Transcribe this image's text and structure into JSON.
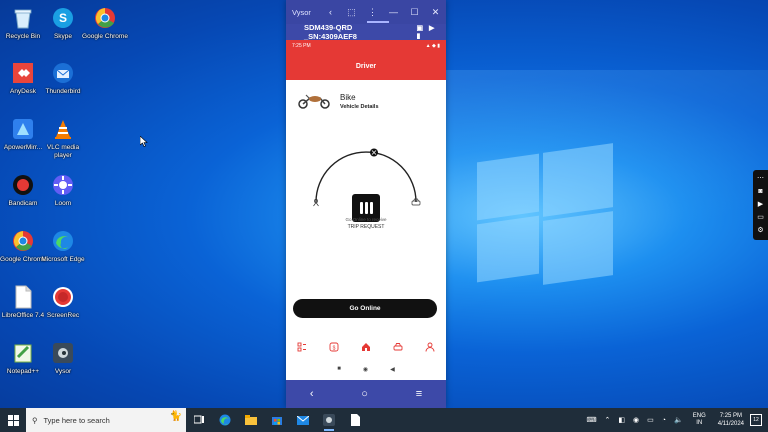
{
  "desktop": {
    "icons": [
      {
        "label": "Recycle Bin"
      },
      {
        "label": "Skype"
      },
      {
        "label": "Google Chrome"
      },
      {
        "label": "AnyDesk"
      },
      {
        "label": "Thunderbird"
      },
      {
        "label": "ApowerMirr..."
      },
      {
        "label": "VLC media player"
      },
      {
        "label": "Bandicam"
      },
      {
        "label": "Loom"
      },
      {
        "label": "Google Chrome"
      },
      {
        "label": "Microsoft Edge"
      },
      {
        "label": "LibreOffice 7.4"
      },
      {
        "label": "ScreenRec"
      },
      {
        "label": "Notepad++"
      },
      {
        "label": "Vysor"
      }
    ]
  },
  "vysor": {
    "title": "Vysor",
    "device": "SDM439-QRD _SN:4309AEF8"
  },
  "phone": {
    "status_time": "7:25 PM",
    "appbar_title": "Driver",
    "vehicle_name": "Bike",
    "vehicle_details": "Vehicle Details",
    "gauge_caption": "Go Online to receive",
    "gauge_status": "TRIP REQUEST",
    "go_online_label": "Go Online"
  },
  "taskbar": {
    "search_placeholder": "Type here to search",
    "lang_line1": "ENG",
    "lang_line2": "IN",
    "time": "7:25 PM",
    "date": "4/11/2024",
    "notification_count": "12"
  },
  "colors": {
    "app_red": "#e53935",
    "vysor_blue": "#3d49a8",
    "taskbar": "#1f2d3a"
  }
}
